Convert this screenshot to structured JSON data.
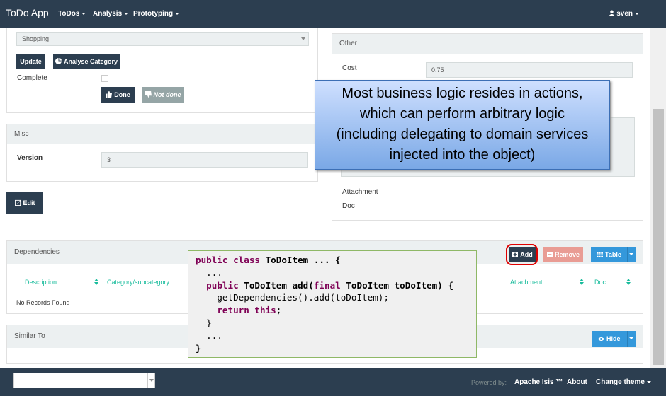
{
  "navbar": {
    "brand": "ToDo App",
    "menus": [
      "ToDos",
      "Analysis",
      "Prototyping"
    ],
    "user": "sven"
  },
  "details": {
    "category_value": "Shopping",
    "update_label": "Update",
    "analyse_label": "Analyse Category",
    "complete_label": "Complete",
    "done_label": "Done",
    "not_done_label": "Not done"
  },
  "misc": {
    "title": "Misc",
    "version_label": "Version",
    "version_value": "3"
  },
  "edit_label": "Edit",
  "other": {
    "title": "Other",
    "cost_label": "Cost",
    "cost_value": "0.75",
    "attachment_label": "Attachment",
    "doc_label": "Doc"
  },
  "dependencies": {
    "title": "Dependencies",
    "add_label": "Add",
    "remove_label": "Remove",
    "table_label": "Table",
    "columns": [
      "Description",
      "Category/subcategory",
      "Attachment",
      "Doc"
    ],
    "empty_text": "No Records Found"
  },
  "similar": {
    "title": "Similar To",
    "hide_label": "Hide"
  },
  "callout": {
    "lines": [
      "Most business logic resides in actions,",
      "which can perform  arbitrary logic",
      "(including delegating to domain services",
      "injected into the object)"
    ]
  },
  "code": {
    "l1_kw": "public class",
    "l1_rest": " ToDoItem ... {",
    "l2": "  ...",
    "l3_kw": "  public",
    "l3_mid": " ToDoItem add(",
    "l3_kw2": "final",
    "l3_rest": " ToDoItem toDoItem) {",
    "l4": "    getDependencies().add(toDoItem);",
    "l5_kw": "    return this",
    "l5_rest": ";",
    "l6": "  }",
    "l7": "  ...",
    "l8": "}"
  },
  "footer": {
    "powered_by": "Powered by:",
    "apache": "Apache Isis ™",
    "about": "About",
    "change_theme": "Change theme"
  },
  "colors": {
    "navbar": "#2c3e50",
    "primary_button": "#2c3e50",
    "danger_button": "#e99c94",
    "info_button": "#3498db",
    "accent_text": "#18bc9c",
    "callout_border": "#3c6fb5",
    "code_border": "#8fb866"
  }
}
